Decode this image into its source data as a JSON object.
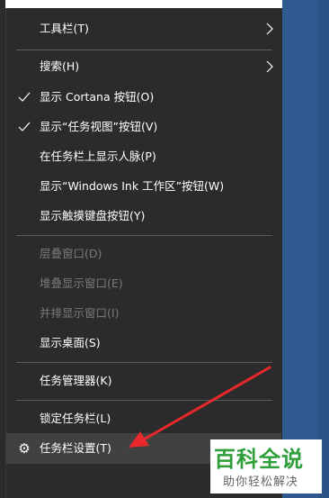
{
  "menu": {
    "items": [
      {
        "label": "工具栏(T)",
        "enabled": true,
        "submenu": true
      },
      {
        "label": "搜索(H)",
        "enabled": true,
        "submenu": true
      },
      {
        "label": "显示 Cortana 按钮(O)",
        "enabled": true,
        "checked": true
      },
      {
        "label": "显示“任务视图”按钮(V)",
        "enabled": true,
        "checked": true
      },
      {
        "label": "在任务栏上显示人脉(P)",
        "enabled": true
      },
      {
        "label": "显示“Windows Ink 工作区”按钮(W)",
        "enabled": true
      },
      {
        "label": "显示触摸键盘按钮(Y)",
        "enabled": true
      },
      {
        "label": "层叠窗口(D)",
        "enabled": false
      },
      {
        "label": "堆叠显示窗口(E)",
        "enabled": false
      },
      {
        "label": "并排显示窗口(I)",
        "enabled": false
      },
      {
        "label": "显示桌面(S)",
        "enabled": true
      },
      {
        "label": "任务管理器(K)",
        "enabled": true
      },
      {
        "label": "锁定任务栏(L)",
        "enabled": true
      },
      {
        "label": "任务栏设置(T)",
        "enabled": true,
        "icon": "gear-icon",
        "hovered": true
      }
    ]
  },
  "watermark": {
    "title": "百科全说",
    "subtitle": "助你轻松解决"
  },
  "colors": {
    "menu_bg": "#2b2b2b",
    "hover_bg": "#414141",
    "separator": "#5c5c5c",
    "disabled_text": "#7a7a7a",
    "arrow": "#e8282b",
    "watermark_green": "#2e9e3a",
    "desktop_blue": "#2f5a8f"
  }
}
